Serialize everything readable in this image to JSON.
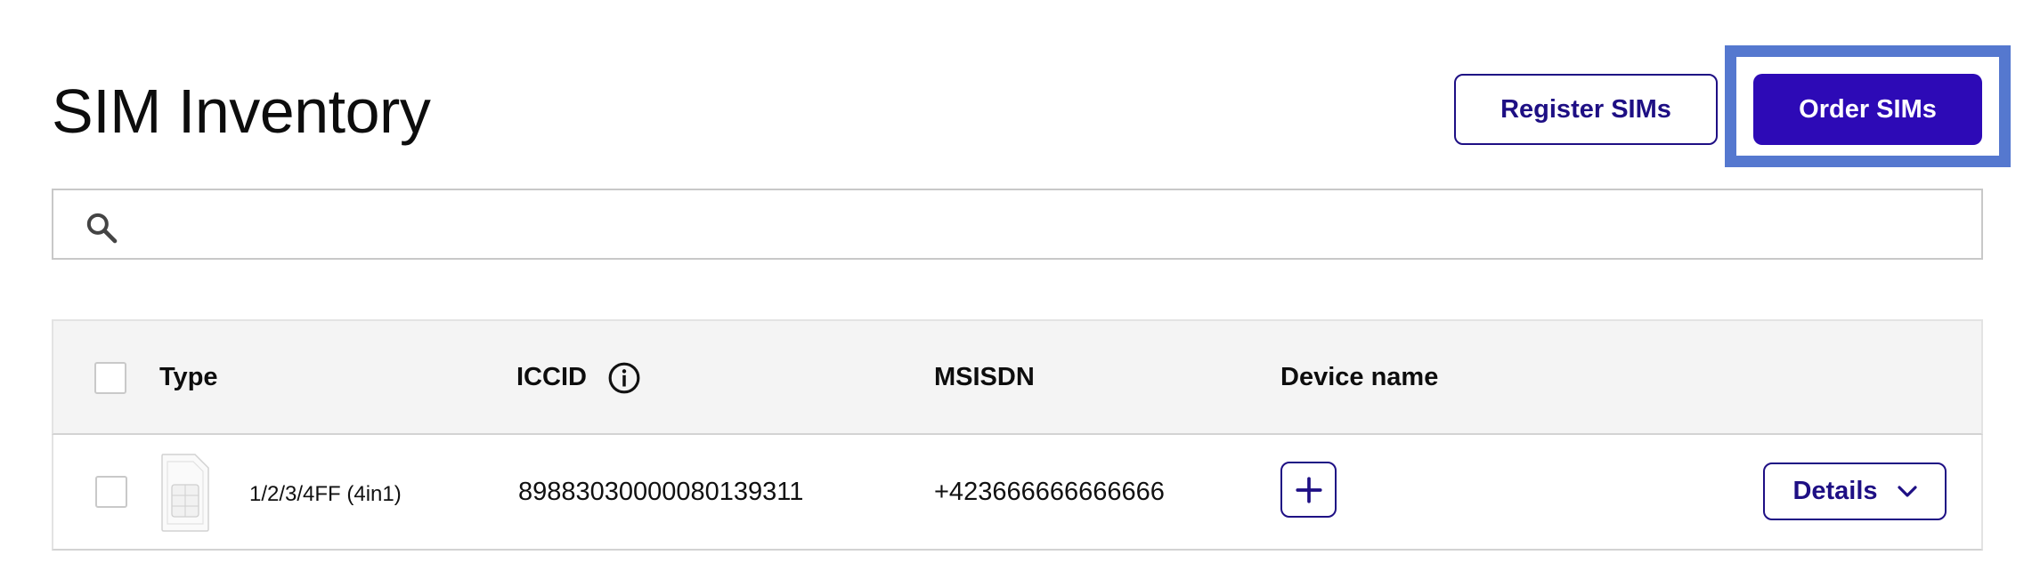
{
  "page": {
    "title": "SIM Inventory"
  },
  "header_actions": {
    "register_label": "Register SIMs",
    "order_label": "Order SIMs"
  },
  "search": {
    "value": "",
    "placeholder": "",
    "icon": "search-icon"
  },
  "table": {
    "columns": {
      "type": "Type",
      "iccid": "ICCID",
      "msisdn": "MSISDN",
      "device_name": "Device name"
    },
    "rows": [
      {
        "type": "1/2/3/4FF (4in1)",
        "iccid": "89883030000080139311",
        "msisdn": "+423666666666666",
        "details_label": "Details",
        "selected": false
      }
    ]
  },
  "colors": {
    "primary": "#2d0ab6",
    "primary_dark": "#1e0f84",
    "focus_ring": "#5578cf",
    "header_bg": "#f4f4f4",
    "border": "#c8c8c8"
  }
}
